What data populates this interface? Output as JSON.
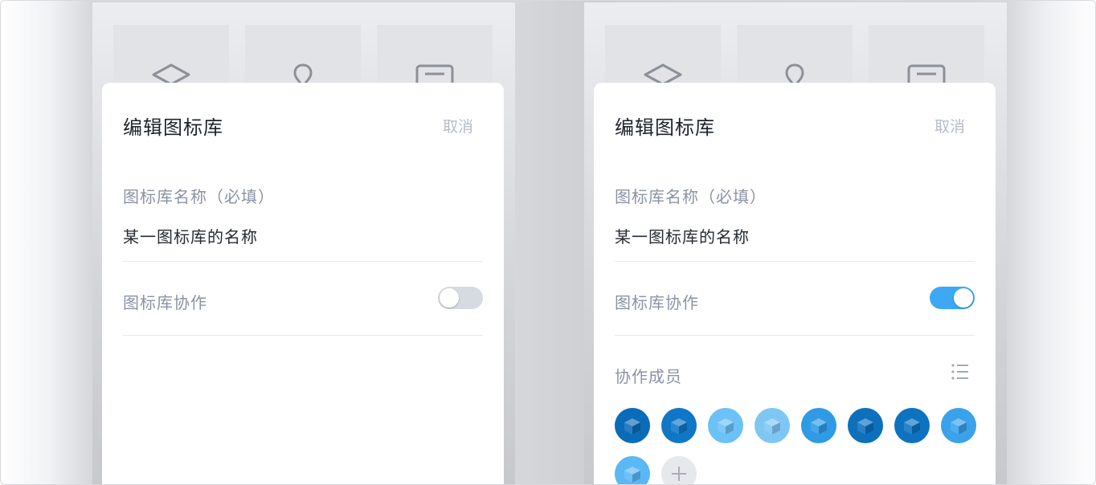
{
  "screens": [
    {
      "id": "collab-off",
      "title": "编辑图标库",
      "cancel_label": "取消",
      "name_label": "图标库名称（必填）",
      "name_value": "某一图标库的名称",
      "collab_label": "图标库协作",
      "collab_enabled": false
    },
    {
      "id": "collab-on",
      "title": "编辑图标库",
      "cancel_label": "取消",
      "name_label": "图标库名称（必填）",
      "name_value": "某一图标库的名称",
      "collab_label": "图标库协作",
      "collab_enabled": true,
      "members_label": "协作成员",
      "members": [
        {
          "color": "#0a6cb8"
        },
        {
          "color": "#0f77c6"
        },
        {
          "color": "#6cc1f7"
        },
        {
          "color": "#7ec7f4"
        },
        {
          "color": "#2f9be6"
        },
        {
          "color": "#0c70bd"
        },
        {
          "color": "#0d73c1"
        },
        {
          "color": "#3aa2ea"
        },
        {
          "color": "#5ab8f5"
        }
      ]
    }
  ],
  "background_tiles": [
    "diamond-icon",
    "pin-icon",
    "document-icon"
  ],
  "colors": {
    "toggle_on": "#3da9f5",
    "toggle_off": "#d6dbe1",
    "label": "#8a93a4",
    "text": "#262a31",
    "cancel": "#b6bcc6"
  }
}
